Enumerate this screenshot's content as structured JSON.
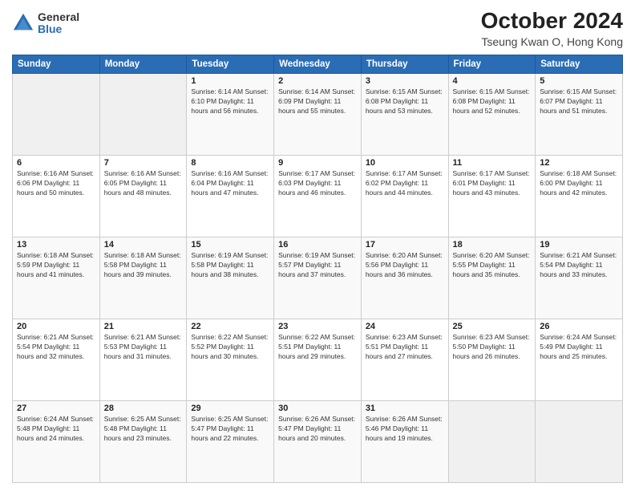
{
  "header": {
    "logo_general": "General",
    "logo_blue": "Blue",
    "month_title": "October 2024",
    "location": "Tseung Kwan O, Hong Kong"
  },
  "days_of_week": [
    "Sunday",
    "Monday",
    "Tuesday",
    "Wednesday",
    "Thursday",
    "Friday",
    "Saturday"
  ],
  "weeks": [
    [
      {
        "day": "",
        "info": ""
      },
      {
        "day": "",
        "info": ""
      },
      {
        "day": "1",
        "info": "Sunrise: 6:14 AM\nSunset: 6:10 PM\nDaylight: 11 hours and 56 minutes."
      },
      {
        "day": "2",
        "info": "Sunrise: 6:14 AM\nSunset: 6:09 PM\nDaylight: 11 hours and 55 minutes."
      },
      {
        "day": "3",
        "info": "Sunrise: 6:15 AM\nSunset: 6:08 PM\nDaylight: 11 hours and 53 minutes."
      },
      {
        "day": "4",
        "info": "Sunrise: 6:15 AM\nSunset: 6:08 PM\nDaylight: 11 hours and 52 minutes."
      },
      {
        "day": "5",
        "info": "Sunrise: 6:15 AM\nSunset: 6:07 PM\nDaylight: 11 hours and 51 minutes."
      }
    ],
    [
      {
        "day": "6",
        "info": "Sunrise: 6:16 AM\nSunset: 6:06 PM\nDaylight: 11 hours and 50 minutes."
      },
      {
        "day": "7",
        "info": "Sunrise: 6:16 AM\nSunset: 6:05 PM\nDaylight: 11 hours and 48 minutes."
      },
      {
        "day": "8",
        "info": "Sunrise: 6:16 AM\nSunset: 6:04 PM\nDaylight: 11 hours and 47 minutes."
      },
      {
        "day": "9",
        "info": "Sunrise: 6:17 AM\nSunset: 6:03 PM\nDaylight: 11 hours and 46 minutes."
      },
      {
        "day": "10",
        "info": "Sunrise: 6:17 AM\nSunset: 6:02 PM\nDaylight: 11 hours and 44 minutes."
      },
      {
        "day": "11",
        "info": "Sunrise: 6:17 AM\nSunset: 6:01 PM\nDaylight: 11 hours and 43 minutes."
      },
      {
        "day": "12",
        "info": "Sunrise: 6:18 AM\nSunset: 6:00 PM\nDaylight: 11 hours and 42 minutes."
      }
    ],
    [
      {
        "day": "13",
        "info": "Sunrise: 6:18 AM\nSunset: 5:59 PM\nDaylight: 11 hours and 41 minutes."
      },
      {
        "day": "14",
        "info": "Sunrise: 6:18 AM\nSunset: 5:58 PM\nDaylight: 11 hours and 39 minutes."
      },
      {
        "day": "15",
        "info": "Sunrise: 6:19 AM\nSunset: 5:58 PM\nDaylight: 11 hours and 38 minutes."
      },
      {
        "day": "16",
        "info": "Sunrise: 6:19 AM\nSunset: 5:57 PM\nDaylight: 11 hours and 37 minutes."
      },
      {
        "day": "17",
        "info": "Sunrise: 6:20 AM\nSunset: 5:56 PM\nDaylight: 11 hours and 36 minutes."
      },
      {
        "day": "18",
        "info": "Sunrise: 6:20 AM\nSunset: 5:55 PM\nDaylight: 11 hours and 35 minutes."
      },
      {
        "day": "19",
        "info": "Sunrise: 6:21 AM\nSunset: 5:54 PM\nDaylight: 11 hours and 33 minutes."
      }
    ],
    [
      {
        "day": "20",
        "info": "Sunrise: 6:21 AM\nSunset: 5:54 PM\nDaylight: 11 hours and 32 minutes."
      },
      {
        "day": "21",
        "info": "Sunrise: 6:21 AM\nSunset: 5:53 PM\nDaylight: 11 hours and 31 minutes."
      },
      {
        "day": "22",
        "info": "Sunrise: 6:22 AM\nSunset: 5:52 PM\nDaylight: 11 hours and 30 minutes."
      },
      {
        "day": "23",
        "info": "Sunrise: 6:22 AM\nSunset: 5:51 PM\nDaylight: 11 hours and 29 minutes."
      },
      {
        "day": "24",
        "info": "Sunrise: 6:23 AM\nSunset: 5:51 PM\nDaylight: 11 hours and 27 minutes."
      },
      {
        "day": "25",
        "info": "Sunrise: 6:23 AM\nSunset: 5:50 PM\nDaylight: 11 hours and 26 minutes."
      },
      {
        "day": "26",
        "info": "Sunrise: 6:24 AM\nSunset: 5:49 PM\nDaylight: 11 hours and 25 minutes."
      }
    ],
    [
      {
        "day": "27",
        "info": "Sunrise: 6:24 AM\nSunset: 5:48 PM\nDaylight: 11 hours and 24 minutes."
      },
      {
        "day": "28",
        "info": "Sunrise: 6:25 AM\nSunset: 5:48 PM\nDaylight: 11 hours and 23 minutes."
      },
      {
        "day": "29",
        "info": "Sunrise: 6:25 AM\nSunset: 5:47 PM\nDaylight: 11 hours and 22 minutes."
      },
      {
        "day": "30",
        "info": "Sunrise: 6:26 AM\nSunset: 5:47 PM\nDaylight: 11 hours and 20 minutes."
      },
      {
        "day": "31",
        "info": "Sunrise: 6:26 AM\nSunset: 5:46 PM\nDaylight: 11 hours and 19 minutes."
      },
      {
        "day": "",
        "info": ""
      },
      {
        "day": "",
        "info": ""
      }
    ]
  ]
}
